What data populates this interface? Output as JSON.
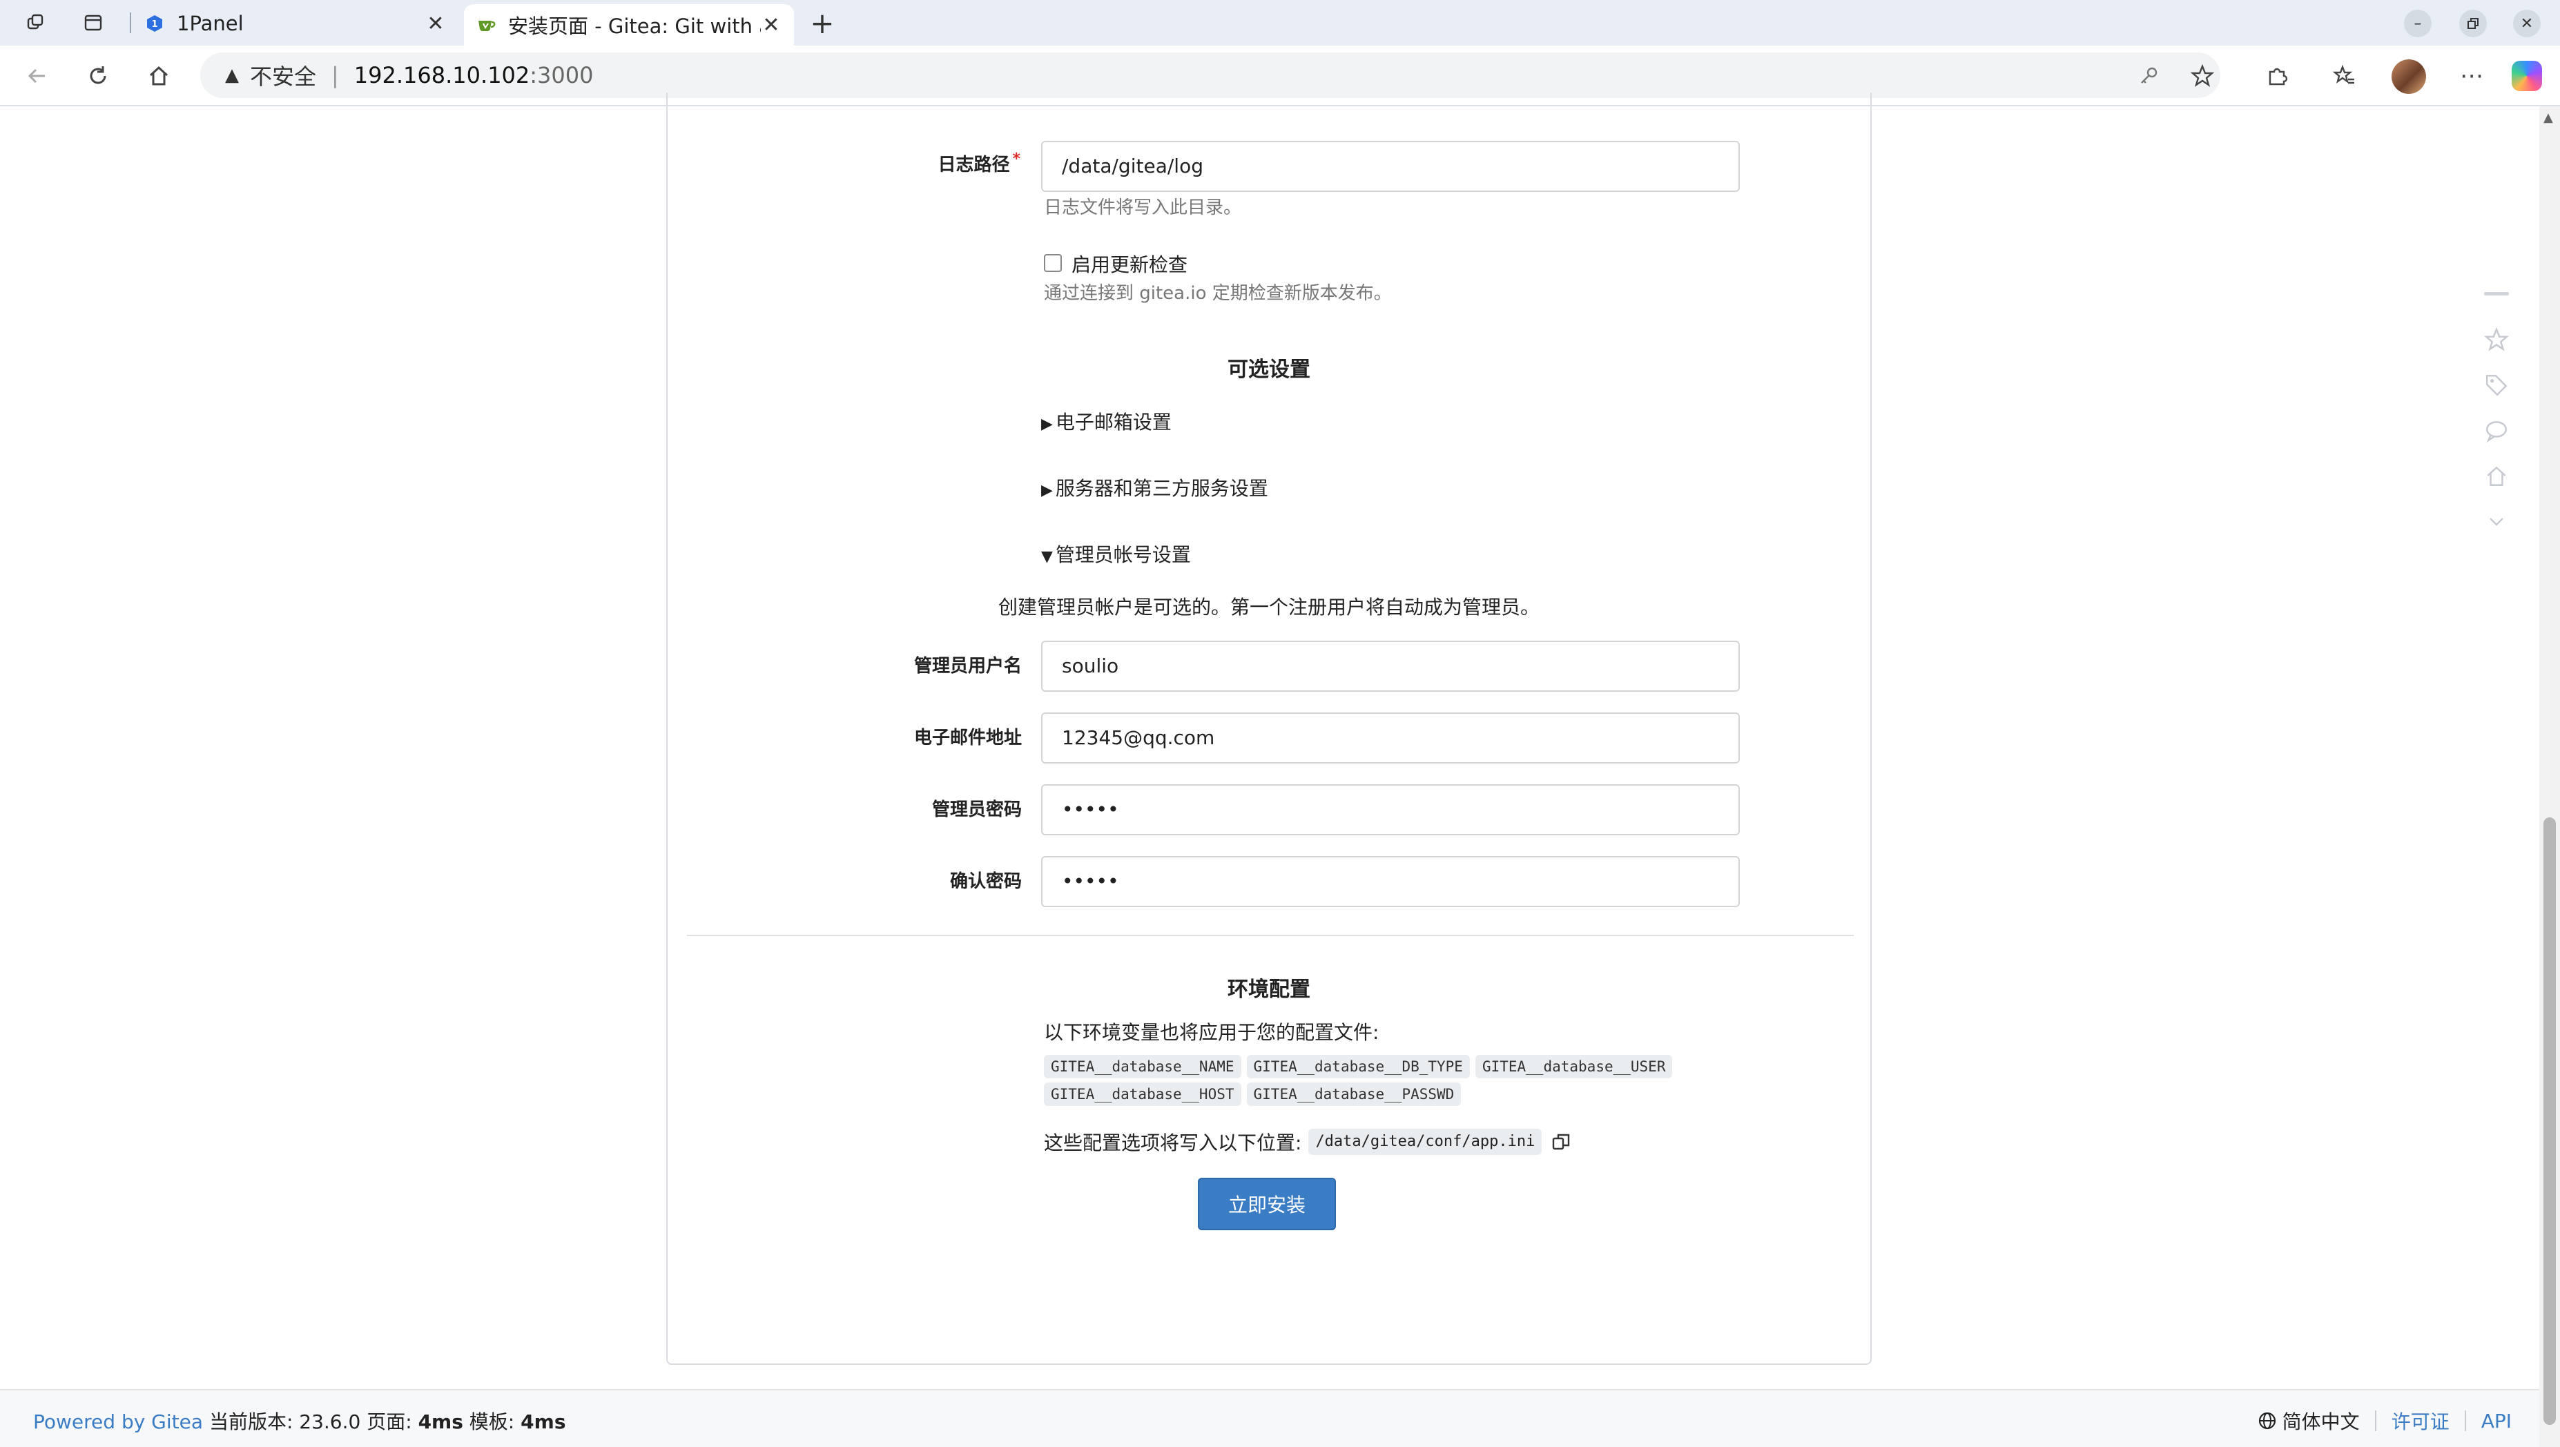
{
  "tabs": [
    {
      "title": "1Panel",
      "active": false
    },
    {
      "title": "安装页面 - Gitea: Git with a cup of tea",
      "active": true
    }
  ],
  "address_bar": {
    "security_label": "不安全",
    "host": "192.168.10.102",
    "port": ":3000"
  },
  "form": {
    "log_path": {
      "label": "日志路径",
      "required_mark": "*",
      "value": "/data/gitea/log",
      "help": "日志文件将写入此目录。"
    },
    "update_checker": {
      "label": "启用更新检查",
      "checked": false,
      "help": "通过连接到 gitea.io 定期检查新版本发布。"
    },
    "optional_settings_title": "可选设置",
    "sections": [
      {
        "label": "电子邮箱设置",
        "expanded": false
      },
      {
        "label": "服务器和第三方服务设置",
        "expanded": false
      },
      {
        "label": "管理员帐号设置",
        "expanded": true
      }
    ],
    "admin_note": "创建管理员帐户是可选的。第一个注册用户将自动成为管理员。",
    "admin_username": {
      "label": "管理员用户名",
      "value": "soulio"
    },
    "admin_email": {
      "label": "电子邮件地址",
      "value": "12345@qq.com"
    },
    "admin_password": {
      "label": "管理员密码",
      "value": "•••••"
    },
    "confirm_password": {
      "label": "确认密码",
      "value": "•••••"
    }
  },
  "env": {
    "title": "环境配置",
    "intro": "以下环境变量也将应用于您的配置文件:",
    "variables": [
      "GITEA__database__NAME",
      "GITEA__database__DB_TYPE",
      "GITEA__database__USER",
      "GITEA__database__HOST",
      "GITEA__database__PASSWD"
    ],
    "write_location_label": "这些配置选项将写入以下位置:",
    "config_path": "/data/gitea/conf/app.ini"
  },
  "install_button": "立即安装",
  "footer": {
    "powered_by": "Powered by Gitea",
    "version_info": "当前版本: 23.6.0 页面: ",
    "page_time": "4ms",
    "template_label": " 模板: ",
    "template_time": "4ms",
    "language": "简体中文",
    "license": "许可证",
    "api": "API"
  },
  "colors": {
    "primary": "#3b7dc4",
    "required": "#db2828",
    "tab_strip": "#e9eef6"
  }
}
